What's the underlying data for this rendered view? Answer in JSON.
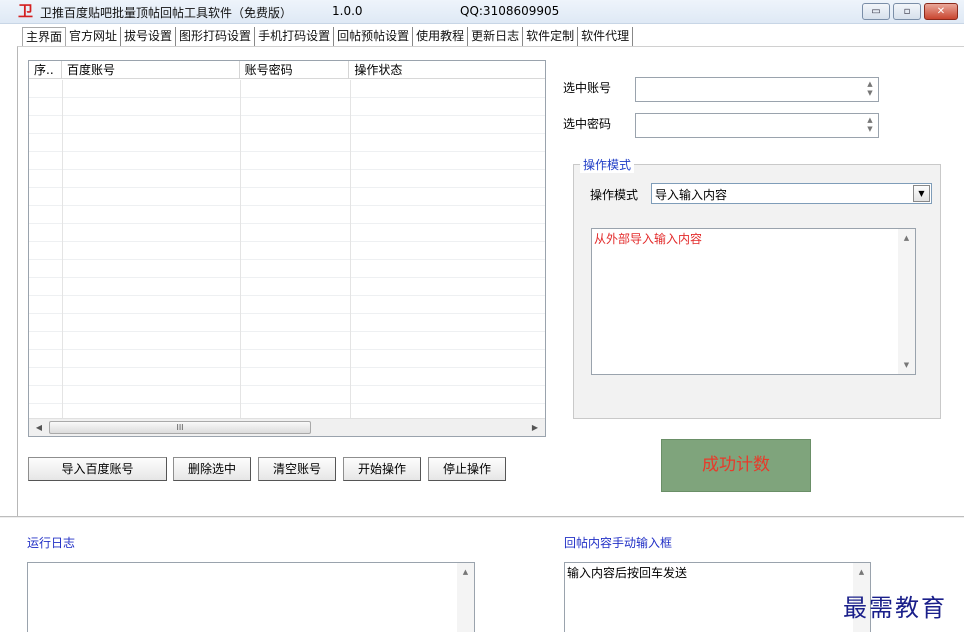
{
  "window": {
    "title": "卫推百度贴吧批量顶帖回帖工具软件（免费版）",
    "version": "1.0.0",
    "qq": "QQ:3108609905",
    "minimize_glyph": "▭",
    "restore_glyph": "▫",
    "close_glyph": "✕"
  },
  "tabs": [
    {
      "label": "主界面"
    },
    {
      "label": "官方网址"
    },
    {
      "label": "拔号设置"
    },
    {
      "label": "图形打码设置"
    },
    {
      "label": "手机打码设置"
    },
    {
      "label": "回帖预帖设置"
    },
    {
      "label": "使用教程"
    },
    {
      "label": "更新日志"
    },
    {
      "label": "软件定制"
    },
    {
      "label": "软件代理"
    }
  ],
  "account_list": {
    "columns": [
      "序..",
      "百度账号",
      "账号密码",
      "操作状态"
    ],
    "scroll_thumb": "III"
  },
  "buttons": {
    "import": "导入百度账号",
    "delete_selected": "删除选中",
    "clear": "清空账号",
    "start": "开始操作",
    "stop": "停止操作"
  },
  "selected": {
    "account_label": "选中账号",
    "password_label": "选中密码",
    "account_value": "",
    "password_value": ""
  },
  "mode": {
    "group_title": "操作模式",
    "label": "操作模式",
    "selected": "导入输入内容",
    "content_hint": "从外部导入输入内容"
  },
  "success": {
    "label": "成功计数"
  },
  "log": {
    "title": "运行日志",
    "content": ""
  },
  "reply_input": {
    "title": "回帖内容手动输入框",
    "content": "输入内容后按回车发送"
  },
  "watermark": "最需教育",
  "colors": {
    "legend_blue": "#2230c6",
    "success_bg": "#7fa47c",
    "success_text": "#e83a2a",
    "hint_red": "#e32b2b"
  }
}
